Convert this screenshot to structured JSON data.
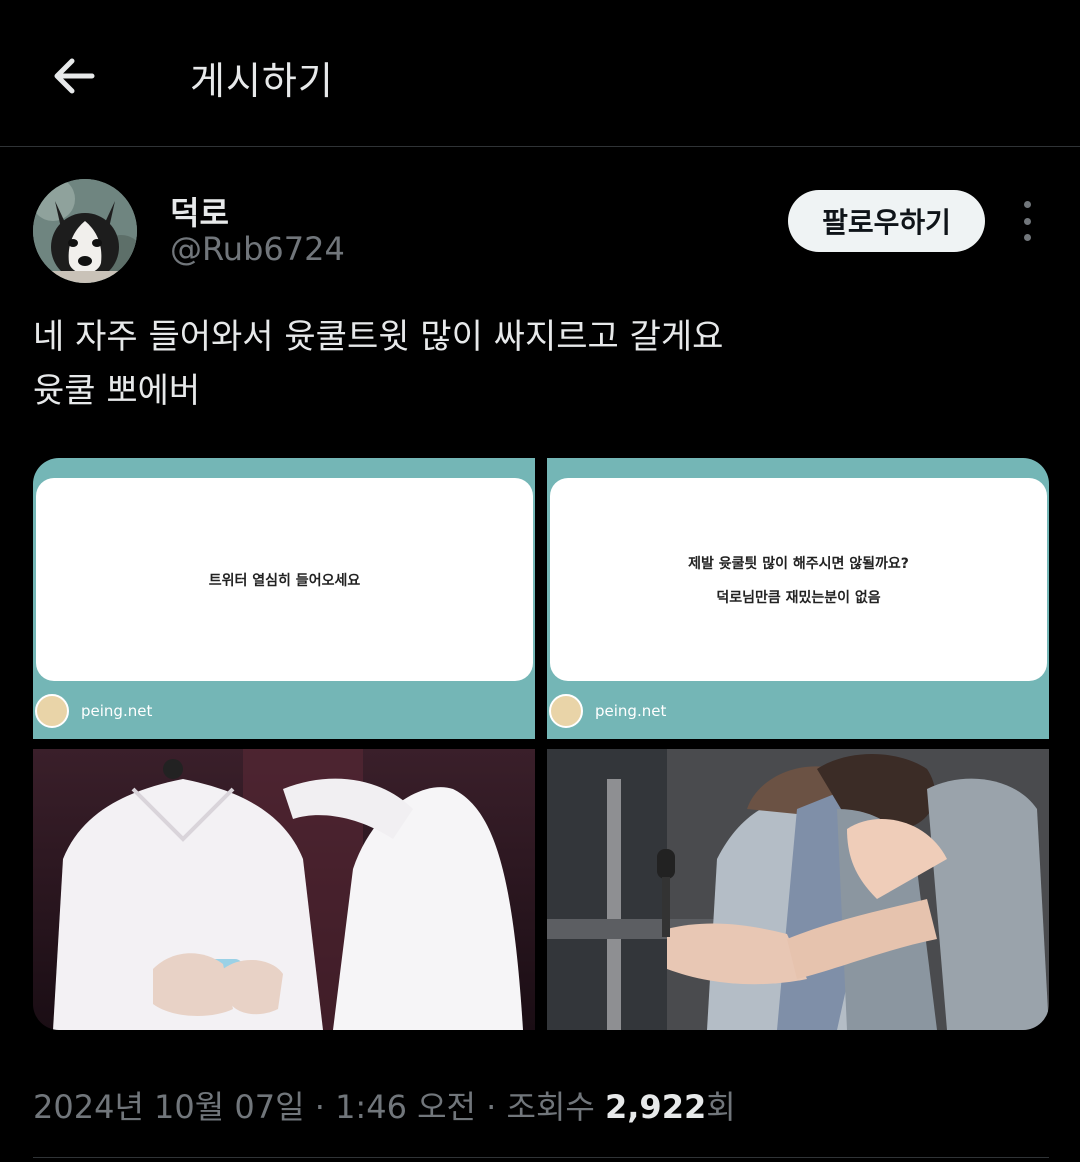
{
  "header": {
    "title": "게시하기",
    "back_icon": "arrow-left-icon"
  },
  "author": {
    "display_name": "덕로",
    "handle": "@Rub6724",
    "avatar_icon": "husky-avatar"
  },
  "follow_label": "팔로우하기",
  "more_icon": "more-vertical-icon",
  "tweet": {
    "lines": [
      "네 자주 들어와서 윳쿨트윗 많이 싸지르고 갈게요",
      "윳쿨 뽀에버"
    ]
  },
  "media": {
    "peing1": {
      "lines": [
        "트위터 열심히 들어오세요"
      ],
      "source": "peing.net"
    },
    "peing2": {
      "lines": [
        "제발 윳쿨틧 많이 해주시면 않될까요?",
        "덕로님만큼 재밌는분이 없음"
      ],
      "source": "peing.net"
    },
    "photo1": {
      "icon": "concert-photo"
    },
    "photo2": {
      "icon": "concert-photo"
    }
  },
  "meta": {
    "date": "2024년 10월 07일",
    "time": "1:46 오전",
    "views_label": "조회수",
    "views_count": "2,922",
    "views_suffix": "회",
    "separator": "·"
  },
  "colors": {
    "background": "#000000",
    "text": "#e7e9ea",
    "muted": "#71767b",
    "peing_teal": "#74b6b6"
  }
}
